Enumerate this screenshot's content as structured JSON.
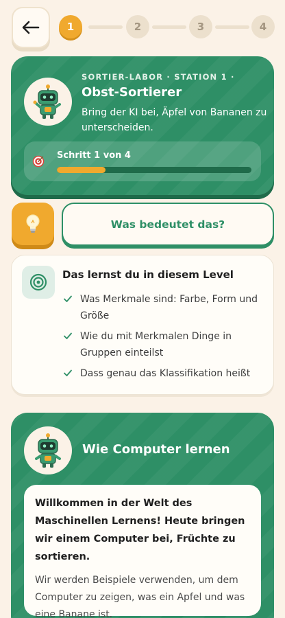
{
  "header": {
    "back_label": "Zurück",
    "steps": [
      {
        "label": "1",
        "state": "active"
      },
      {
        "label": "2",
        "state": "inactive"
      },
      {
        "label": "3",
        "state": "inactive"
      },
      {
        "label": "4",
        "state": "inactive"
      }
    ]
  },
  "hero": {
    "kicker": "SORTIER-LABOR · STATION 1 ·",
    "title": "Obst-Sortierer",
    "subtitle": "Bring der KI bei, Äpfel von Bananen zu unterscheiden.",
    "avatar_icon": "robot-icon",
    "progress": {
      "icon": "target-icon",
      "label": "Schritt 1 von 4",
      "fraction": 0.25
    }
  },
  "hint": {
    "bulb_icon": "lightbulb-icon",
    "meaning_label": "Was bedeutet das?"
  },
  "learn": {
    "icon": "target-rings-icon",
    "title": "Das lernst du in diesem Level",
    "items": [
      "Was Merkmale sind: Farbe, Form und Größe",
      "Wie du mit Merkmalen Dinge in Gruppen einteilst",
      "Dass genau das Klassifikation heißt"
    ]
  },
  "lesson": {
    "avatar_icon": "robot-icon",
    "title": "Wie Computer lernen",
    "lead": "Willkommen in der Welt des Maschinellen Lernens! Heute bringen wir einem Computer bei, Früchte zu sortieren.",
    "body": "Wir werden Beispiele verwenden, um dem Computer zu zeigen, was ein Apfel und was eine Banane ist."
  },
  "colors": {
    "background": "#fbf2e7",
    "primary_green": "#2e8f66",
    "accent_orange": "#f0a92e",
    "card": "#fffdf8"
  }
}
